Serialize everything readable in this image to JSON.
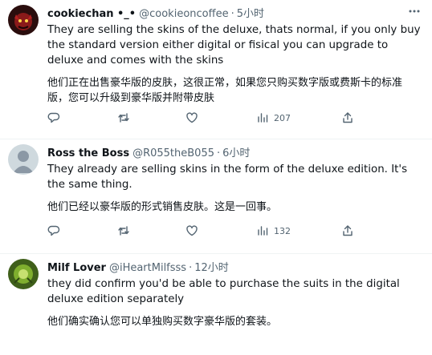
{
  "tweets": [
    {
      "name": "cookiechan •_•",
      "handle": "@cookieoncoffee",
      "separator": "·",
      "time": "5小时",
      "text": "They are selling the skins of the deluxe, thats normal, if you only buy the standard version either digital or fisical you can upgrade to deluxe and comes with the skins",
      "translation": "他们正在出售豪华版的皮肤，这很正常，如果您只购买数字版或费斯卡的标准版，您可以升级到豪华版并附带皮肤",
      "views": "207"
    },
    {
      "name": "Ross the Boss",
      "handle": "@R055theB055",
      "separator": "·",
      "time": "6小时",
      "text": "They already are selling skins in the form of the deluxe edition. It's the same thing.",
      "translation": "他们已经以豪华版的形式销售皮肤。这是一回事。",
      "views": "132"
    },
    {
      "name": "Milf Lover",
      "handle": "@iHeartMilfsss",
      "separator": "·",
      "time": "12小时",
      "text": "they did confirm you'd be able to purchase the suits in the digital deluxe edition separately",
      "translation": "他们确实确认您可以单独购买数字豪华版的套装。"
    }
  ],
  "icons": [
    "reply-icon",
    "retweet-icon",
    "like-icon",
    "views-icon",
    "share-icon",
    "more-icon"
  ],
  "colors": {
    "text": "#0f1419",
    "secondary": "#536471",
    "divider": "#eff3f4"
  }
}
